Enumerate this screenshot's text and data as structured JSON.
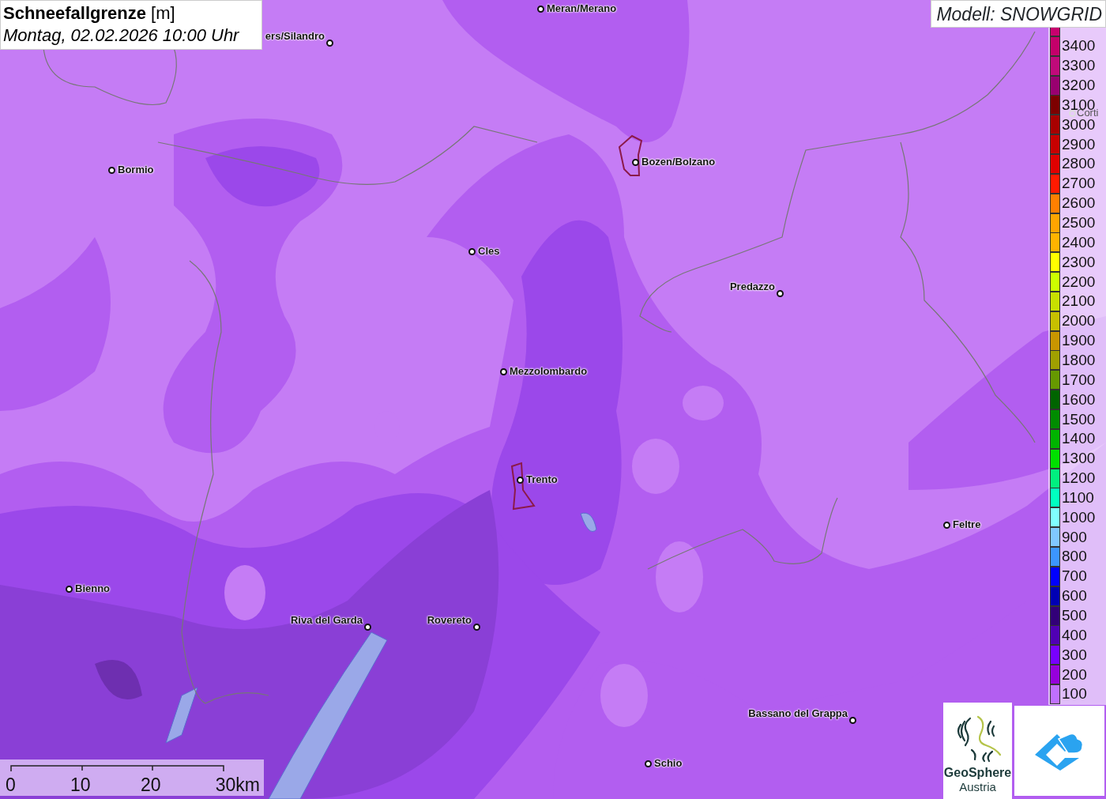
{
  "title": {
    "heading": "**Schneefallgrenze** [m]",
    "subtitle": "Montag, 02.02.2026 10:00 Uhr"
  },
  "model_label": "Modell: SNOWGRID",
  "cities": [
    {
      "name": "Meran/Merano",
      "kind": "right"
    },
    {
      "name": "ers/Silandro",
      "kind": "left"
    },
    {
      "name": "Bormio",
      "kind": "right"
    },
    {
      "name": "Bozen/Bolzano",
      "kind": "right"
    },
    {
      "name": "Cles",
      "kind": "right"
    },
    {
      "name": "Predazzo",
      "kind": "left"
    },
    {
      "name": "Mezzolombardo",
      "kind": "right"
    },
    {
      "name": "Trento",
      "kind": "right"
    },
    {
      "name": "Feltre",
      "kind": "right"
    },
    {
      "name": "Bienno",
      "kind": "right"
    },
    {
      "name": "Riva del Garda",
      "kind": "left"
    },
    {
      "name": "Rovereto",
      "kind": "left"
    },
    {
      "name": "Bassano del Grappa",
      "kind": "left"
    },
    {
      "name": "Schio",
      "kind": "right"
    },
    {
      "name": "Corti",
      "kind": "faded"
    }
  ],
  "legend": [
    {
      "color": "#c8006e"
    },
    {
      "label": "3400",
      "color": "#c4006a"
    },
    {
      "label": "3300",
      "color": "#c00a7a"
    },
    {
      "label": "3200",
      "color": "#990070"
    },
    {
      "label": "3100",
      "color": "#7d0000"
    },
    {
      "label": "3000",
      "color": "#a80000"
    },
    {
      "label": "2900",
      "color": "#c80000"
    },
    {
      "label": "2800",
      "color": "#e00000"
    },
    {
      "label": "2700",
      "color": "#ff1a00"
    },
    {
      "label": "2600",
      "color": "#ff8000"
    },
    {
      "label": "2500",
      "color": "#ffa500"
    },
    {
      "label": "2400",
      "color": "#ffb400"
    },
    {
      "label": "2300",
      "color": "#ffff00"
    },
    {
      "label": "2200",
      "color": "#ccff00"
    },
    {
      "label": "2100",
      "color": "#c8e000"
    },
    {
      "label": "2000",
      "color": "#c8c000"
    },
    {
      "label": "1900",
      "color": "#c89600"
    },
    {
      "label": "1800",
      "color": "#a0a000"
    },
    {
      "label": "1700",
      "color": "#669900"
    },
    {
      "label": "1600",
      "color": "#006400"
    },
    {
      "label": "1500",
      "color": "#008c00"
    },
    {
      "label": "1400",
      "color": "#00b400"
    },
    {
      "label": "1300",
      "color": "#00e000"
    },
    {
      "label": "1200",
      "color": "#00f080"
    },
    {
      "label": "1100",
      "color": "#00ffc0"
    },
    {
      "label": "1000",
      "color": "#80ffff"
    },
    {
      "label": "900",
      "color": "#80c8ff"
    },
    {
      "label": "800",
      "color": "#3c96ff"
    },
    {
      "label": "700",
      "color": "#0000ff"
    },
    {
      "label": "600",
      "color": "#0000b4"
    },
    {
      "label": "500",
      "color": "#320078"
    },
    {
      "label": "400",
      "color": "#5000b4"
    },
    {
      "label": "300",
      "color": "#7800ff"
    },
    {
      "label": "200",
      "color": "#9600dc"
    },
    {
      "label": "100",
      "color": "#c070ff"
    }
  ],
  "scale": [
    "0",
    "10",
    "20",
    "30km"
  ],
  "logo": {
    "name": "GeoSphere",
    "country": "Austria"
  }
}
